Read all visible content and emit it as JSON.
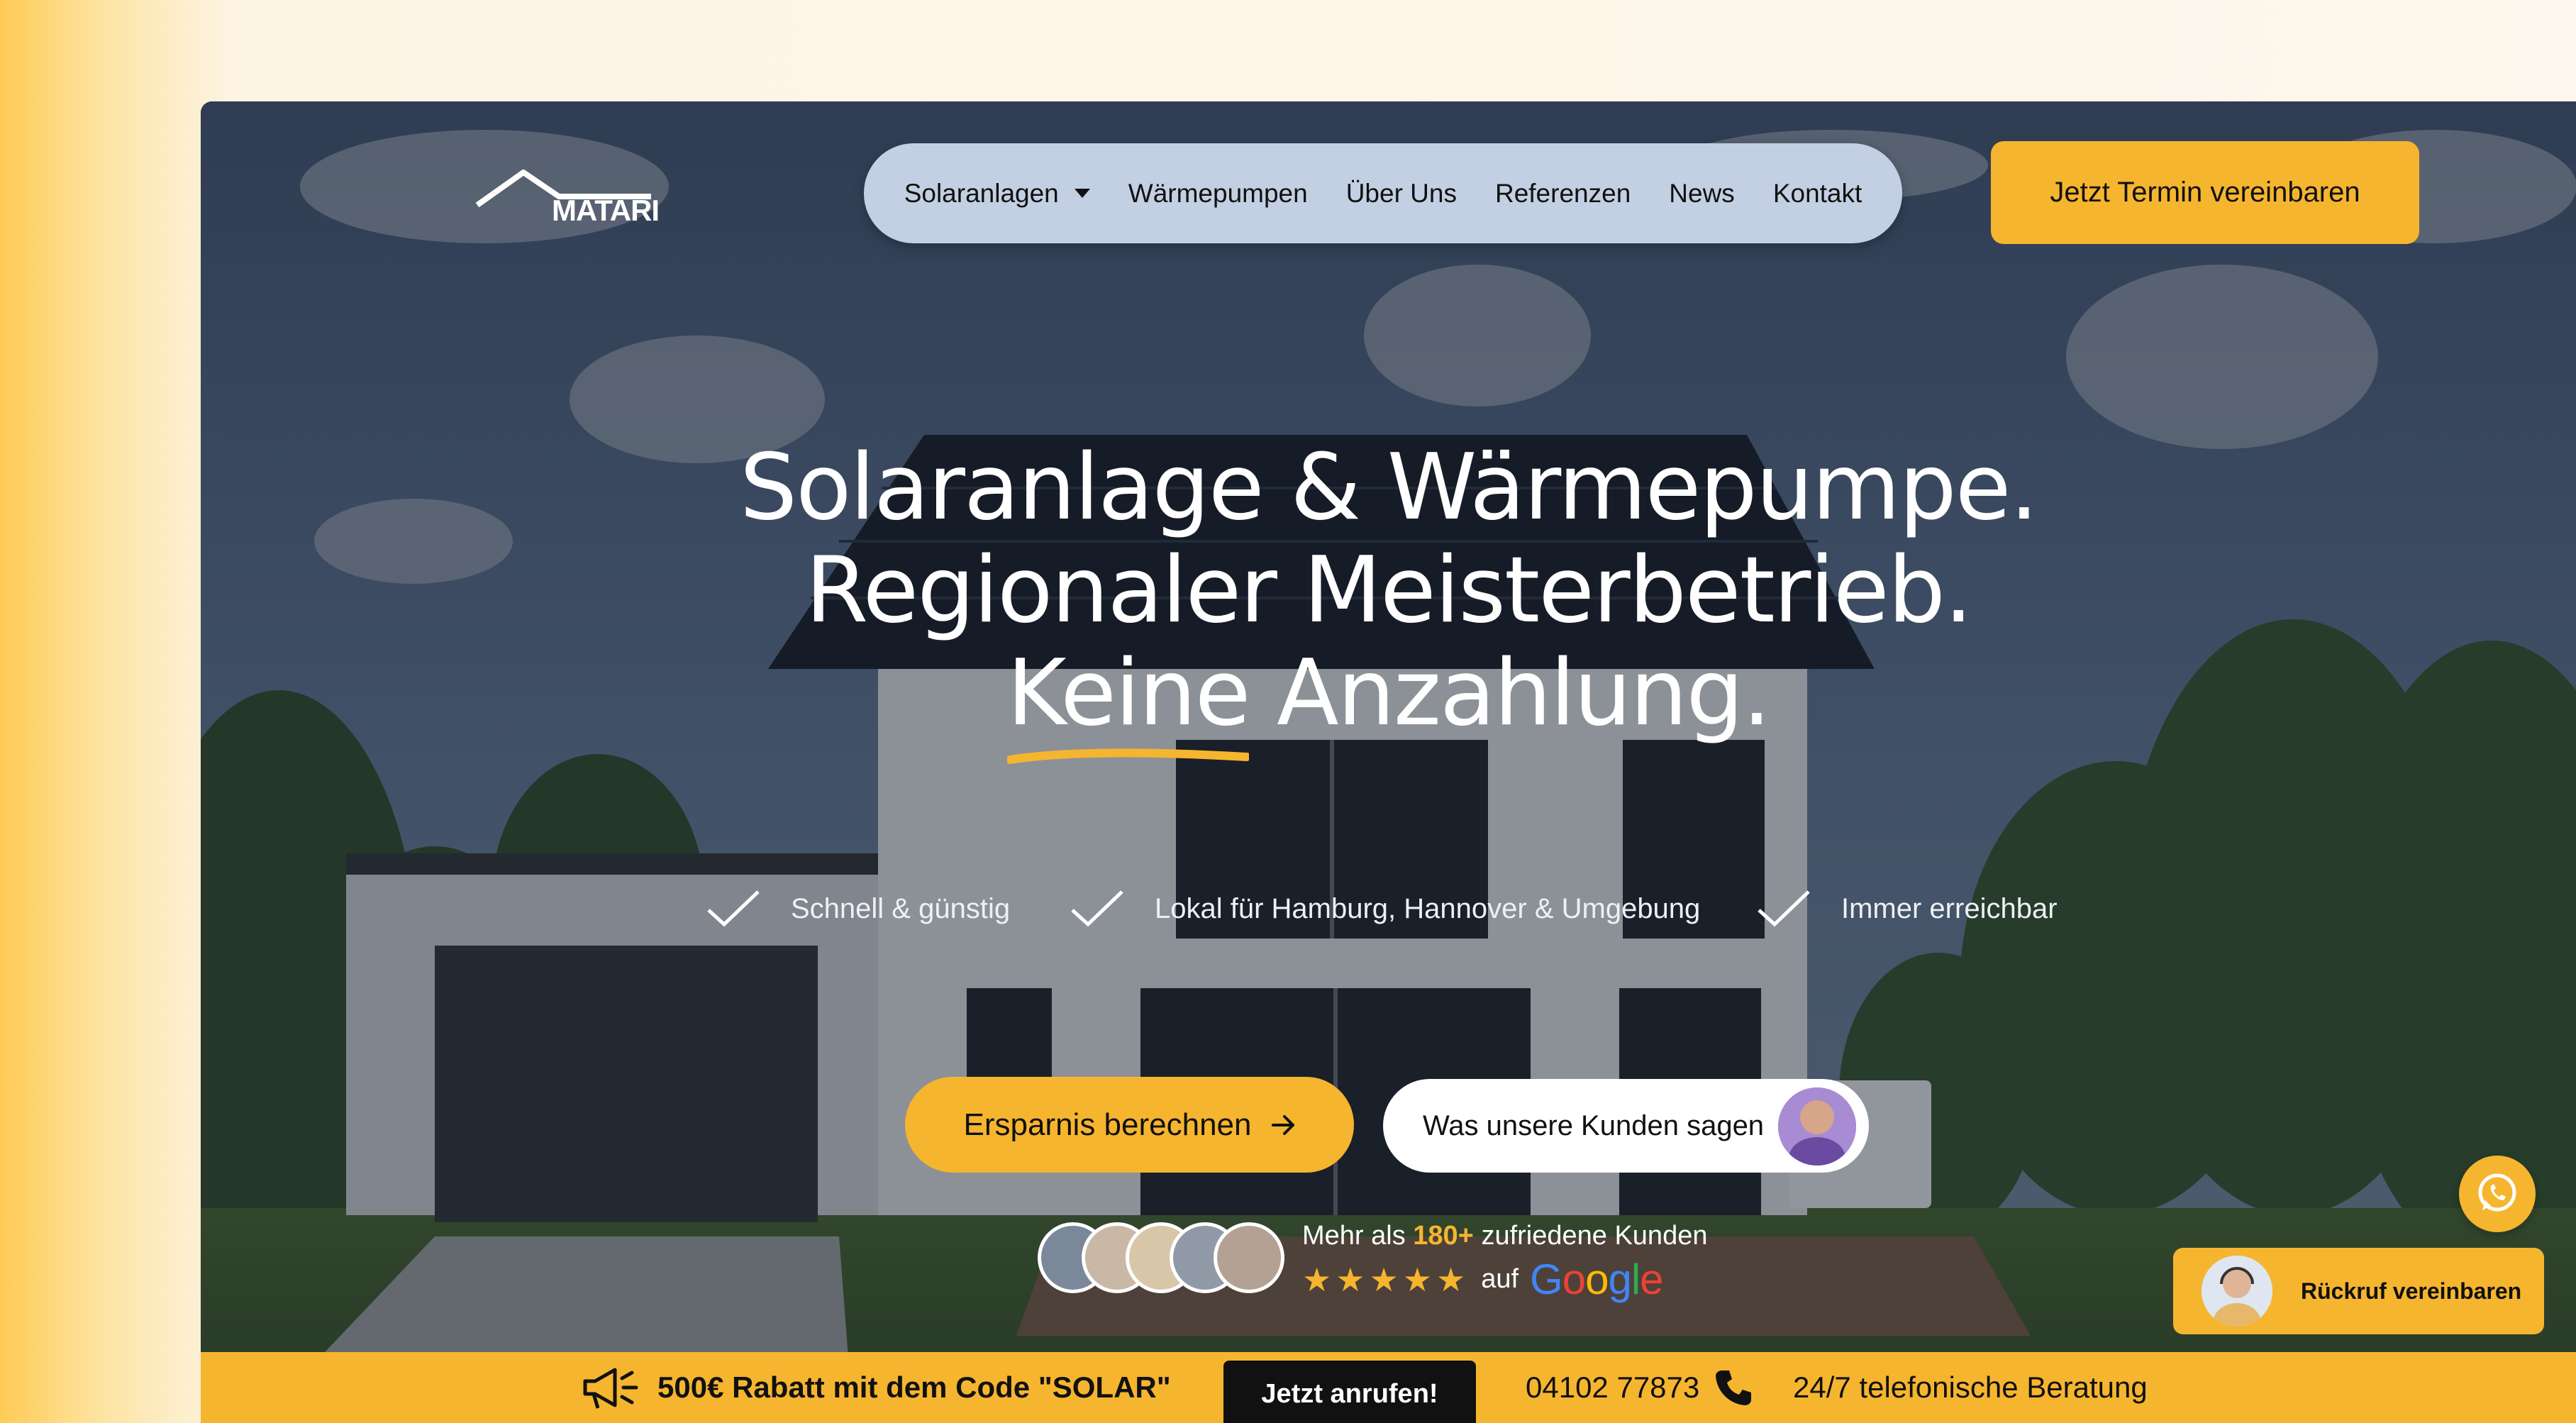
{
  "brand": {
    "logo_text": "MATARI"
  },
  "nav": {
    "items": [
      {
        "label": "Solaranlagen",
        "has_dropdown": true
      },
      {
        "label": "Wärmepumpen"
      },
      {
        "label": "Über Uns"
      },
      {
        "label": "Referenzen"
      },
      {
        "label": "News"
      },
      {
        "label": "Kontakt"
      }
    ],
    "cta_label": "Jetzt Termin vereinbaren"
  },
  "hero": {
    "line1": "Solaranlage & Wärmepumpe.",
    "line2": "Regionaler Meisterbetrieb.",
    "line3_highlight": "Keine",
    "line3_rest": " Anzahlung.",
    "features": [
      "Schnell & günstig",
      "Lokal für Hamburg, Hannover & Umgebung",
      "Immer erreichbar"
    ],
    "primary_button": "Ersparnis berechnen",
    "secondary_button": "Was unsere Kunden sagen"
  },
  "social_proof": {
    "prefix": "Mehr als",
    "count": "180+",
    "suffix": "zufriedene Kunden",
    "stars": "★★★★★",
    "rating_word": "auf",
    "platform": "Google"
  },
  "widgets": {
    "callback_label": "Rückruf vereinbaren",
    "whatsapp_icon": "whatsapp-icon"
  },
  "bottom_bar": {
    "promo": "500€ Rabatt mit dem Code \"SOLAR\"",
    "call_button": "Jetzt anrufen!",
    "phone": "04102 77873",
    "advice": "24/7 telefonische Beratung"
  },
  "colors": {
    "accent": "#f6b52f",
    "nav_bg": "#c3d0e3",
    "dark": "#111111"
  }
}
